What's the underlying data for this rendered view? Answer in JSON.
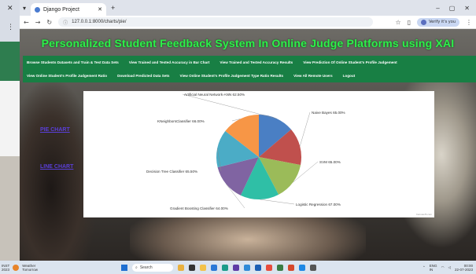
{
  "browser": {
    "tab_title": "Django Project",
    "url": "127.0.0.1:8000/charts/pie/",
    "profile_label": "Verify it's you"
  },
  "page": {
    "title": "Personalized Student Feedback System In Online Judge Platforms using XAI",
    "menu_row1": [
      "Browse Students Datasets and Train & Test Data Sets",
      "View Trained and Tested Accuracy in Bar Chart",
      "View Trained and Tested Accuracy Results",
      "View Prediction Of Online Student's Profile Judgement"
    ],
    "menu_row2": [
      "View Online Student's Profile Judgement Ratio",
      "Download Predicted Data Sets",
      "View Online Student's Profile Judgement Type Ratio Results",
      "View All Remote Users",
      "Logout"
    ],
    "side_links": {
      "pie": "PIE CHART",
      "line": "LINE CHART"
    }
  },
  "chart_data": {
    "type": "pie",
    "slices": [
      {
        "label": "Artificial Neural Network-ANN",
        "value": 62.5,
        "color": "#4a7fc4"
      },
      {
        "label": "Naive Bayes",
        "value": 65.0,
        "color": "#c0504d"
      },
      {
        "label": "SVM",
        "value": 65.0,
        "color": "#9bbb59"
      },
      {
        "label": "Logistic Regression",
        "value": 67.0,
        "color": "#2fbfa6"
      },
      {
        "label": "Gradient Boosting Classifier",
        "value": 64.0,
        "color": "#8064a2"
      },
      {
        "label": "Decision Tree Classifier",
        "value": 65.5,
        "color": "#4bacc6"
      },
      {
        "label": "KNeighborsClassifier",
        "value": 66.0,
        "color": "#f79646"
      }
    ],
    "display_labels": [
      "Artificial Neural Network-ANN 62.50%",
      "Naive Bayes 65.00%",
      "SVM 65.00%",
      "Logistic Regression 67.00%",
      "Gradient Boosting Classifier 64.00%",
      "Decision Tree Classifier 65.50%",
      "KNeighborsClassifier 66.00%"
    ],
    "credit": "CanvasJS.com"
  },
  "taskbar": {
    "time_left": "INST\n2023",
    "weather": "Weather\nTomorrow",
    "search": "Search",
    "clock_time": "00:00",
    "clock_date": "22-07-2023",
    "lang": "ENG\nIN"
  }
}
